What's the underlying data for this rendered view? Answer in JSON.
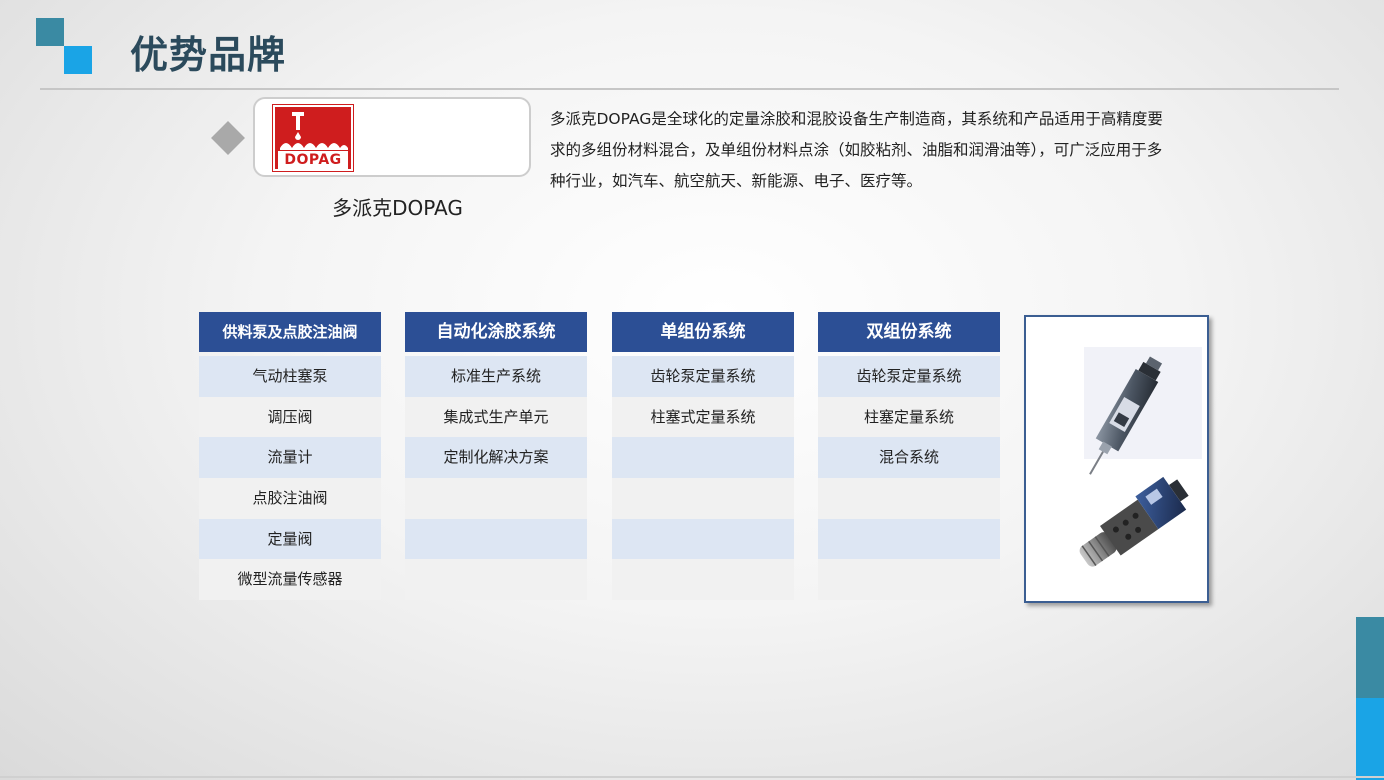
{
  "title": "优势品牌",
  "brand": {
    "logo_text": "DOPAG",
    "caption": "多派克DOPAG",
    "description": "多派克DOPAG是全球化的定量涂胶和混胶设备生产制造商，其系统和产品适用于高精度要求的多组份材料混合，及单组份材料点涂（如胶粘剂、油脂和润滑油等），可广泛应用于多种行业，如汽车、航空航天、新能源、电子、医疗等。"
  },
  "columns": [
    {
      "header": "供料泵及点胶注油阀",
      "items": [
        "气动柱塞泵",
        "调压阀",
        "流量计",
        "点胶注油阀",
        "定量阀",
        "微型流量传感器"
      ]
    },
    {
      "header": "自动化涂胶系统",
      "items": [
        "标准生产系统",
        "集成式生产单元",
        "定制化解决方案",
        "",
        "",
        ""
      ]
    },
    {
      "header": "单组份系统",
      "items": [
        "齿轮泵定量系统",
        "柱塞式定量系统",
        "",
        "",
        "",
        ""
      ]
    },
    {
      "header": "双组份系统",
      "items": [
        "齿轮泵定量系统",
        "柱塞定量系统",
        "混合系统",
        "",
        "",
        ""
      ]
    }
  ],
  "colors": {
    "header_bg": "#2c4f95",
    "row_alt": "#dde6f3",
    "accent_teal": "#3a8aa3",
    "accent_blue": "#1aa4e6",
    "logo_red": "#cf1d1e"
  },
  "icons": {
    "bullet": "diamond-bullet-icon",
    "product_top": "dispensing-valve-icon",
    "product_bottom": "metering-valve-icon"
  }
}
